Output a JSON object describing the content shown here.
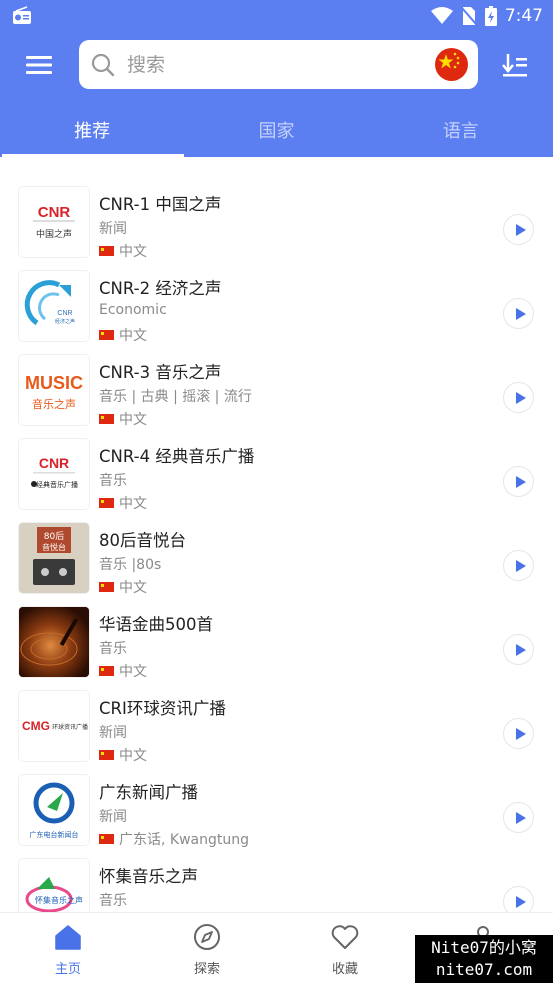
{
  "status_bar": {
    "time": "7:47"
  },
  "search": {
    "placeholder": "搜索"
  },
  "tabs": [
    {
      "label": "推荐",
      "active": true
    },
    {
      "label": "国家",
      "active": false
    },
    {
      "label": "语言",
      "active": false
    }
  ],
  "stations": [
    {
      "title": "CNR-1 中国之声",
      "subtitle": "新闻",
      "language": "中文",
      "logo": "CNR 中国之声"
    },
    {
      "title": "CNR-2 经济之声",
      "subtitle": "Economic",
      "language": "中文",
      "logo": "CNR 经济之声"
    },
    {
      "title": "CNR-3 音乐之声",
      "subtitle": "音乐 | 古典 | 摇滚 | 流行",
      "language": "中文",
      "logo": "MUSIC 音乐之声"
    },
    {
      "title": "CNR-4 经典音乐广播",
      "subtitle": "音乐",
      "language": "中文",
      "logo": "CNR 经典音乐广播"
    },
    {
      "title": "80后音悦台",
      "subtitle": "音乐 |80s",
      "language": "中文",
      "logo": "80后 音悦台"
    },
    {
      "title": "华语金曲500首",
      "subtitle": "音乐",
      "language": "中文",
      "logo": ""
    },
    {
      "title": "CRI环球资讯广播",
      "subtitle": "新闻",
      "language": "中文",
      "logo": "CMG 环球资讯广播"
    },
    {
      "title": "广东新闻广播",
      "subtitle": "新闻",
      "language": "广东话, Kwangtung",
      "logo": "广东电台新闻台"
    },
    {
      "title": "怀集音乐之声",
      "subtitle": "音乐",
      "language": "",
      "logo": "怀集音乐之声"
    }
  ],
  "bottom_nav": [
    {
      "label": "主页",
      "icon": "home-icon",
      "active": true
    },
    {
      "label": "探索",
      "icon": "compass-icon",
      "active": false
    },
    {
      "label": "收藏",
      "icon": "heart-icon",
      "active": false
    },
    {
      "label": "",
      "icon": "user-icon",
      "active": false
    }
  ],
  "watermark": {
    "line1": "Nite07的小窝",
    "line2": "nite07.com"
  },
  "colors": {
    "primary": "#5b7ef1",
    "accent": "#4a72e8",
    "flag_red": "#de2910"
  }
}
